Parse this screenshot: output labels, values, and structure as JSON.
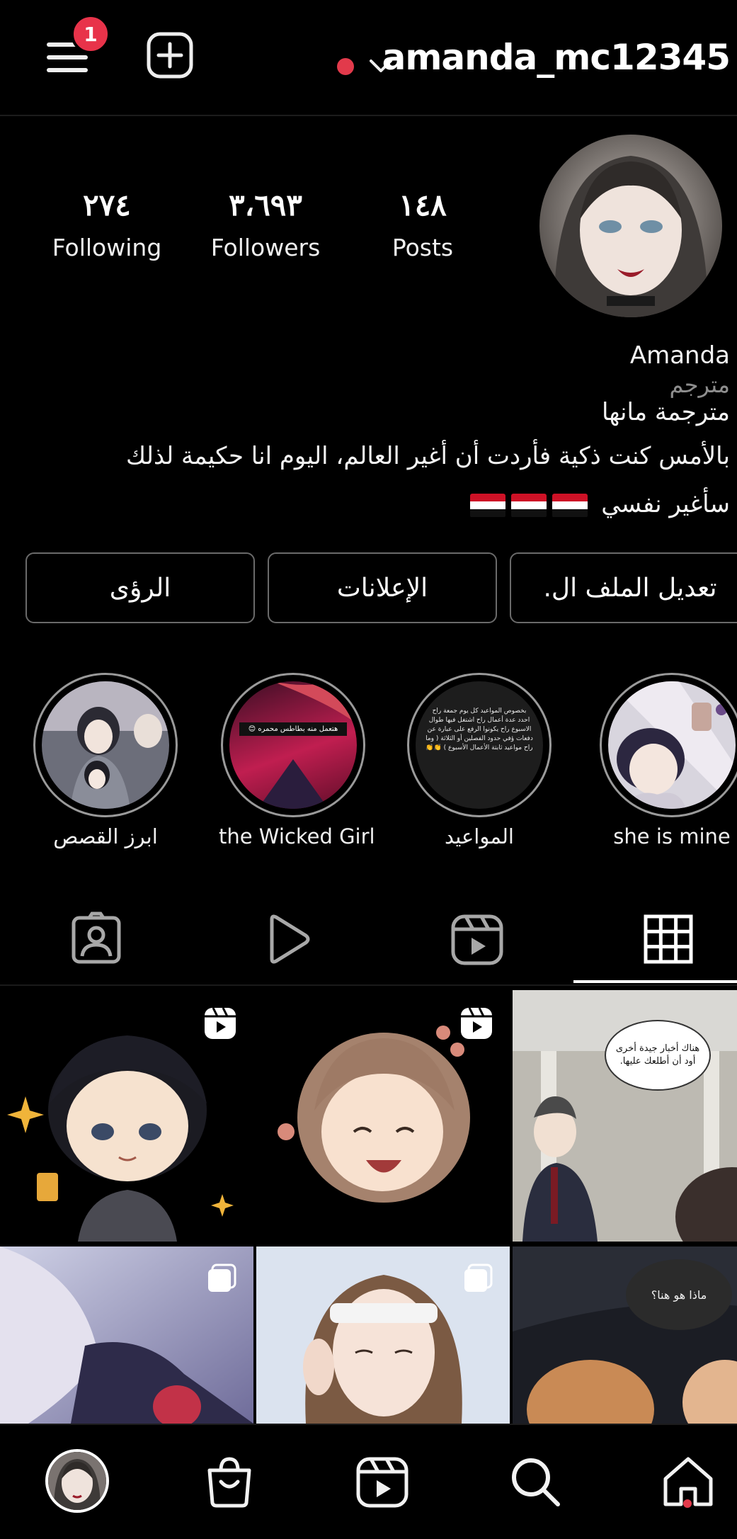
{
  "header": {
    "username": "amanda_mc12345",
    "notification_count": "1",
    "live_dot_color": "#e23a4b",
    "icons": [
      "menu-icon",
      "add-post-icon",
      "chevron-down-icon"
    ]
  },
  "stats": {
    "following": {
      "value": "٢٧٤",
      "label": "Following"
    },
    "followers": {
      "value": "٣،٦٩٣",
      "label": "Followers"
    },
    "posts": {
      "value": "١٤٨",
      "label": "Posts"
    }
  },
  "bio": {
    "name": "Amanda",
    "category": "مترجم",
    "line1": "مترجمة مانها",
    "line2": "بالأمس كنت ذكية فأردت أن أغير العالم، اليوم انا حكيمة لذلك",
    "line3": "سأغير نفسي"
  },
  "actions": {
    "edit_profile": "تعديل الملف ال.",
    "ads": "الإعلانات",
    "insights": "الرؤى"
  },
  "highlights": [
    {
      "title": "she is mine"
    },
    {
      "title": "المواعيد",
      "cover_text": "بخصوص المواعيد كل يوم جمعة راح احدد عدة أعمال راح اشتغل فيها طوال الاسبوع راح يكونوا الرفع على عبارة عن دفعات ؤفي حدود الفصلين أو الثلاثة ( وما راح مواعيد ثابتة الأعمال الأسبوع ) 👏👏"
    },
    {
      "title": "the Wicked Girl",
      "cover_text": "هتعمل منه بطاطس محمره 😊"
    },
    {
      "title": "ابرز القصص"
    }
  ],
  "tabs": {
    "items": [
      "tagged-icon",
      "videos-icon",
      "reels-icon",
      "grid-icon"
    ],
    "active": "grid"
  },
  "grid": {
    "post3_bubble": "هناك أخبار جيدة أخرى أود أن أطلعك عليها.",
    "post6_bubble": "ماذا هو هنا؟"
  },
  "bottom_nav": {
    "items": [
      "profile-avatar",
      "shop-icon",
      "reels-icon",
      "search-icon",
      "home-icon"
    ],
    "active_dot_color": "#e23a4b"
  }
}
